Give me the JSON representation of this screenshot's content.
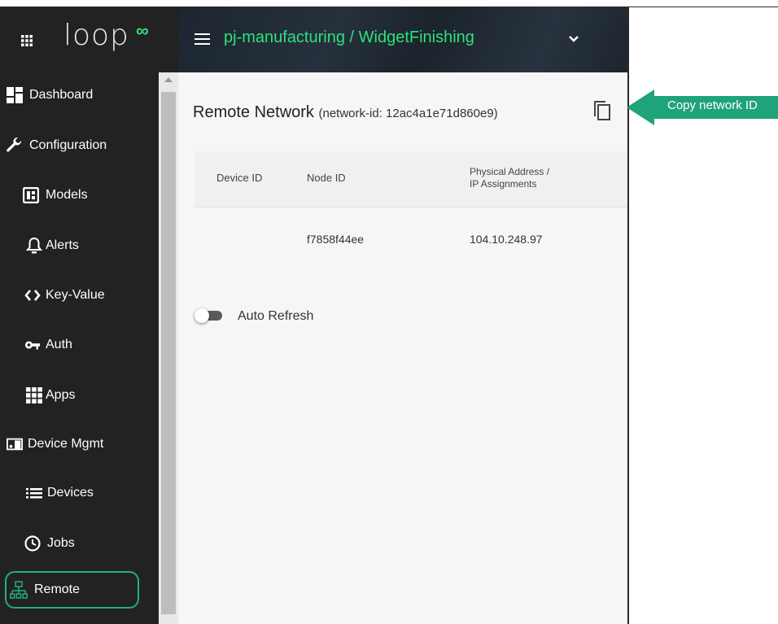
{
  "brand": {
    "logo_text": "loop",
    "logo_mark": "∞",
    "accent": "#2ee07a"
  },
  "header": {
    "project_title": "pj-manufacturing / WidgetFinishing"
  },
  "sidebar": {
    "items": [
      {
        "label": "Dashboard",
        "icon": "dashboard-icon"
      },
      {
        "label": "Configuration",
        "icon": "wrench-icon"
      },
      {
        "label": "Models",
        "icon": "models-icon"
      },
      {
        "label": "Alerts",
        "icon": "bell-icon"
      },
      {
        "label": "Key-Value",
        "icon": "code-icon"
      },
      {
        "label": "Auth",
        "icon": "key-icon"
      },
      {
        "label": "Apps",
        "icon": "apps-icon"
      },
      {
        "label": "Device Mgmt",
        "icon": "device-mgmt-icon"
      },
      {
        "label": "Devices",
        "icon": "list-icon"
      },
      {
        "label": "Jobs",
        "icon": "clock-icon"
      },
      {
        "label": "Remote",
        "icon": "network-icon"
      }
    ],
    "active": "Remote"
  },
  "main": {
    "title": "Remote Network",
    "subtitle": "(network-id: 12ac4a1e71d860e9)",
    "table": {
      "columns": [
        "Device ID",
        "Node ID",
        "Physical Address /",
        "IP Assignments"
      ],
      "rows": [
        {
          "device_id": "",
          "node_id": "f7858f44ee",
          "address": "104.10.248.97"
        }
      ]
    },
    "auto_refresh": {
      "label": "Auto Refresh",
      "enabled": false
    }
  },
  "callout": {
    "text": "Copy network ID",
    "color": "#1fa37a"
  }
}
